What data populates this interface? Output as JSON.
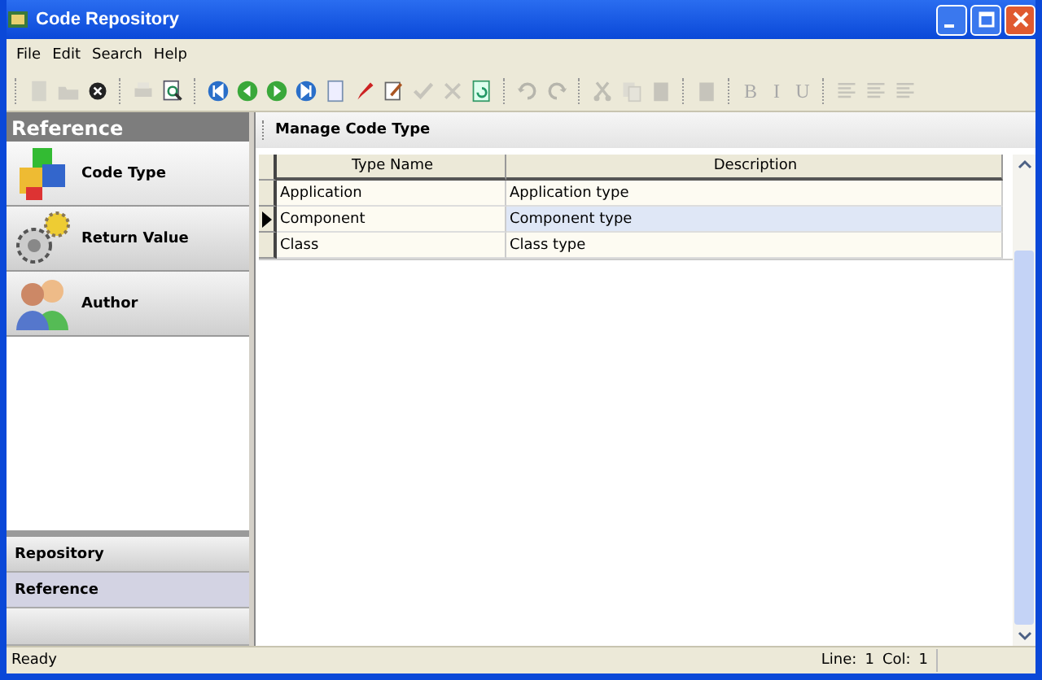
{
  "window": {
    "title": "Code Repository"
  },
  "menu": [
    "File",
    "Edit",
    "Search",
    "Help"
  ],
  "toolbar": [
    [
      {
        "kind": "new",
        "disabled": true
      },
      {
        "kind": "open",
        "disabled": true
      },
      {
        "kind": "close",
        "disabled": false
      }
    ],
    [
      {
        "kind": "print",
        "disabled": true
      },
      {
        "kind": "preview",
        "disabled": false
      }
    ],
    [
      {
        "kind": "first",
        "disabled": false
      },
      {
        "kind": "prev",
        "disabled": false
      },
      {
        "kind": "next",
        "disabled": false
      },
      {
        "kind": "last",
        "disabled": false
      },
      {
        "kind": "page",
        "disabled": false
      },
      {
        "kind": "pen",
        "disabled": false
      },
      {
        "kind": "edit",
        "disabled": false
      },
      {
        "kind": "check",
        "disabled": true
      },
      {
        "kind": "cross",
        "disabled": true
      },
      {
        "kind": "refresh",
        "disabled": false
      }
    ],
    [
      {
        "kind": "undo",
        "disabled": true
      },
      {
        "kind": "redo",
        "disabled": true
      }
    ],
    [
      {
        "kind": "cut",
        "disabled": true
      },
      {
        "kind": "copy",
        "disabled": true
      },
      {
        "kind": "paste",
        "disabled": true
      }
    ],
    [
      {
        "kind": "paste",
        "disabled": true
      }
    ],
    [
      {
        "kind": "letter",
        "text": "B",
        "disabled": true
      },
      {
        "kind": "letter",
        "text": "I",
        "disabled": true
      },
      {
        "kind": "letter",
        "text": "U",
        "disabled": true
      }
    ],
    [
      {
        "kind": "align",
        "disabled": true
      },
      {
        "kind": "align",
        "disabled": true
      },
      {
        "kind": "align",
        "disabled": true
      }
    ]
  ],
  "sidebar": {
    "header": "Reference",
    "items": [
      {
        "label": "Code Type",
        "kind": "blocks",
        "selected": true
      },
      {
        "label": "Return Value",
        "kind": "gears",
        "selected": false
      },
      {
        "label": "Author",
        "kind": "people",
        "selected": false
      }
    ],
    "sections": [
      {
        "label": "Repository",
        "selected": false
      },
      {
        "label": "Reference",
        "selected": true
      }
    ]
  },
  "panel": {
    "title": "Manage Code Type",
    "table": {
      "columns": [
        "Type Name",
        "Description"
      ],
      "rows": [
        {
          "cells": [
            "Application",
            "Application type"
          ],
          "selected": false
        },
        {
          "cells": [
            "Component",
            "Component type"
          ],
          "selected": true
        },
        {
          "cells": [
            "Class",
            "Class type"
          ],
          "selected": false
        }
      ]
    }
  },
  "status_bar": {
    "message": "Ready",
    "line_label": "Line:",
    "line": "1",
    "col_label": "Col:",
    "col": "1"
  }
}
